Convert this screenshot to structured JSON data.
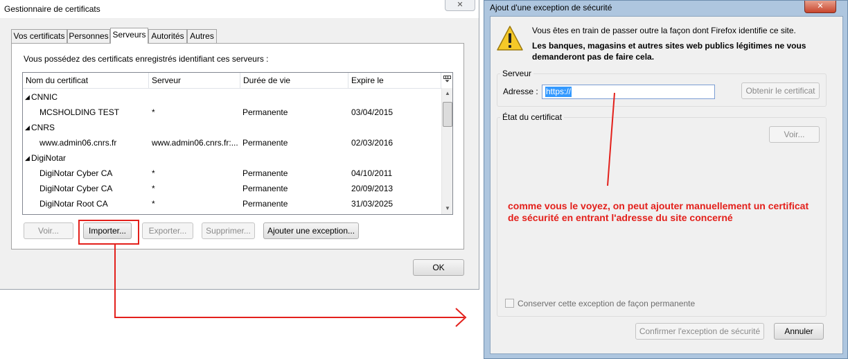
{
  "cert_manager": {
    "title": "Gestionnaire de certificats",
    "close_label": "✕",
    "tabs": [
      "Vos certificats",
      "Personnes",
      "Serveurs",
      "Autorités",
      "Autres"
    ],
    "active_tab": "Serveurs",
    "intro": "Vous possédez des certificats enregistrés identifiant ces serveurs :",
    "columns": [
      "Nom du certificat",
      "Serveur",
      "Durée de vie",
      "Expire le"
    ],
    "column_picker_icon": "column-picker-icon",
    "rows": [
      {
        "type": "group",
        "name": "CNNIC",
        "expander": "◢"
      },
      {
        "type": "item",
        "name": "MCSHOLDING TEST",
        "server": "*",
        "lifetime": "Permanente",
        "expires": "03/04/2015"
      },
      {
        "type": "group",
        "name": "CNRS",
        "expander": "◢"
      },
      {
        "type": "item",
        "name": "www.admin06.cnrs.fr",
        "server": "www.admin06.cnrs.fr:...",
        "lifetime": "Permanente",
        "expires": "02/03/2016"
      },
      {
        "type": "group",
        "name": "DigiNotar",
        "expander": "◢"
      },
      {
        "type": "item",
        "name": "DigiNotar Cyber CA",
        "server": "*",
        "lifetime": "Permanente",
        "expires": "04/10/2011"
      },
      {
        "type": "item",
        "name": "DigiNotar Cyber CA",
        "server": "*",
        "lifetime": "Permanente",
        "expires": "20/09/2013"
      },
      {
        "type": "item",
        "name": "DigiNotar Root CA",
        "server": "*",
        "lifetime": "Permanente",
        "expires": "31/03/2025"
      }
    ],
    "buttons": {
      "view": "Voir...",
      "import": "Importer...",
      "export": "Exporter...",
      "delete": "Supprimer...",
      "add_exception": "Ajouter une exception...",
      "ok": "OK"
    }
  },
  "exception_dialog": {
    "title": "Ajout d'une exception de sécurité",
    "close_label": "✕",
    "warning_line1": "Vous êtes en train de passer outre la façon dont Firefox identifie ce site.",
    "warning_line2": "Les banques, magasins et autres sites web publics légitimes ne vous demanderont pas de faire cela.",
    "server_group": "Serveur",
    "address_label": "Adresse :",
    "address_value": "https://",
    "get_cert_button": "Obtenir le certificat",
    "cert_status_group": "État du certificat",
    "view_button": "Voir...",
    "permanent_checkbox_label": "Conserver cette exception de façon permanente",
    "permanent_checked": false,
    "confirm_button": "Confirmer l'exception de sécurité",
    "cancel_button": "Annuler"
  },
  "annotation": {
    "text": "comme vous le voyez, on peut ajouter manuellement un certificat de sécurité en entrant l'adresse du site concerné",
    "color": "#e3201b"
  },
  "colors": {
    "accent_red": "#e3201b",
    "selection_blue": "#3399ff",
    "dialog_frame": "#aec6df"
  }
}
